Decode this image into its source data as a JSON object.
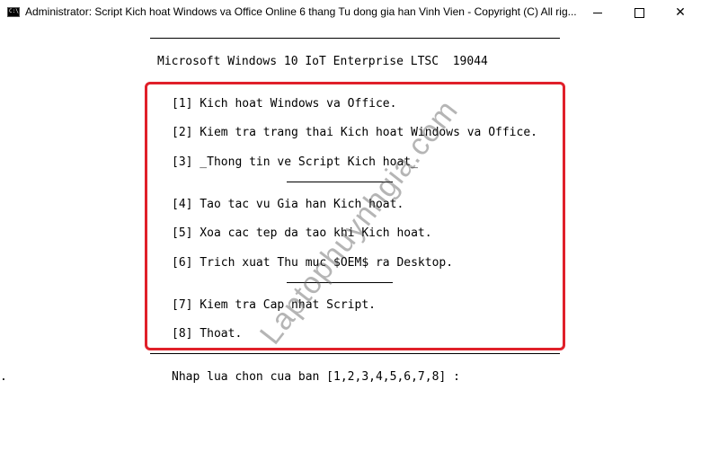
{
  "window": {
    "title": "Administrator:  Script Kich hoat Windows va Office Online 6 thang Tu dong gia han Vinh Vien - Copyright (C) All rig...",
    "buttons": {
      "minimize_icon": "minimize-icon",
      "maximize_icon": "maximize-icon",
      "close_glyph": "✕"
    }
  },
  "console": {
    "os_line": "Microsoft Windows 10 IoT Enterprise LTSC  19044",
    "menu_items": [
      "[1] Kich hoat Windows va Office.",
      "[2] Kiem tra trang thai Kich hoat Windows va Office.",
      "[3] _Thong tin ve Script Kich hoat_",
      "[4] Tao tac vu Gia han Kich hoat.",
      "[5] Xoa cac tep da tao khi Kich hoat.",
      "[6] Trich xuat Thu muc $OEM$ ra Desktop.",
      "[7] Kiem tra Cap nhat Script.",
      "[8] Thoat."
    ],
    "prompt": "Nhap lua chon cua ban [1,2,3,4,5,6,7,8] :",
    "left_dot": "."
  },
  "watermark": "Laptophuynhgia.com",
  "colors": {
    "highlight_box": "#e0202a",
    "background": "#ffffff",
    "text": "#000000"
  }
}
